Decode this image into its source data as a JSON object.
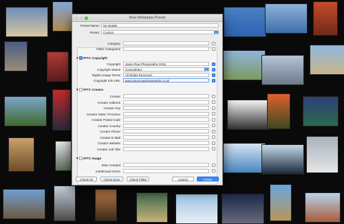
{
  "window": {
    "title": "New Metadata Preset"
  },
  "header": {
    "preset_name_label": "Preset Name:",
    "preset_name_value": "My Details",
    "preset_label": "Preset:",
    "preset_value": "Custom"
  },
  "top_fields": [
    {
      "label": "Category",
      "value": ""
    },
    {
      "label": "Other Categories",
      "value": ""
    }
  ],
  "iptc_copyright": {
    "section_label": "IPTC Copyright",
    "fields": [
      {
        "label": "Copyright",
        "value": "Jason Row Photography 2015"
      },
      {
        "label": "Copyright Status",
        "value": "Copyrighted"
      },
      {
        "label": "Rights Usage Terms",
        "value": "All Rights Reserved"
      },
      {
        "label": "Copyright Info URL",
        "value": "www.jasonrowphotography.co.uk"
      }
    ]
  },
  "iptc_creator": {
    "section_label": "IPTC Creator",
    "fields": [
      {
        "label": "Creator"
      },
      {
        "label": "Creator Address"
      },
      {
        "label": "Creator City"
      },
      {
        "label": "Creator State / Province"
      },
      {
        "label": "Creator Postal Code"
      },
      {
        "label": "Creator Country"
      },
      {
        "label": "Creator Phone"
      },
      {
        "label": "Creator E-Mail"
      },
      {
        "label": "Creator Website"
      },
      {
        "label": "Creator Job Title"
      }
    ]
  },
  "iptc_image": {
    "section_label": "IPTC Image",
    "fields": [
      {
        "label": "Date Created"
      },
      {
        "label": "Intellectual Genre"
      }
    ]
  },
  "footer": {
    "check_all": "Check All",
    "check_none": "Check None",
    "check_filled": "Check Filled",
    "cancel": "Cancel",
    "create": "Create"
  },
  "colors": {
    "accent": "#3b8bf5",
    "dialog_bg": "#ececec",
    "background": "#0a0a0a"
  }
}
